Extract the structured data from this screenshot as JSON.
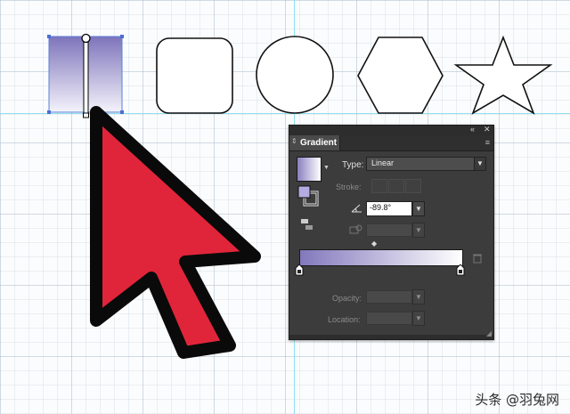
{
  "panel": {
    "title": "Gradient",
    "collapse_icon": "«",
    "close_icon": "✕",
    "type_label": "Type:",
    "type_value": "Linear",
    "stroke_label": "Stroke:",
    "angle_value": "-89.8°",
    "opacity_label": "Opacity:",
    "location_label": "Location:"
  },
  "colors": {
    "gradient_start": "#8278bc",
    "gradient_end": "#ffffff",
    "cursor_fill": "#e0253a",
    "guide": "#8ee0f0",
    "panel_bg": "#3c3c3c"
  },
  "shapes": [
    "rectangle-gradient",
    "rounded-rectangle",
    "circle",
    "hexagon",
    "star"
  ],
  "watermark": "头条 @羽兔网"
}
